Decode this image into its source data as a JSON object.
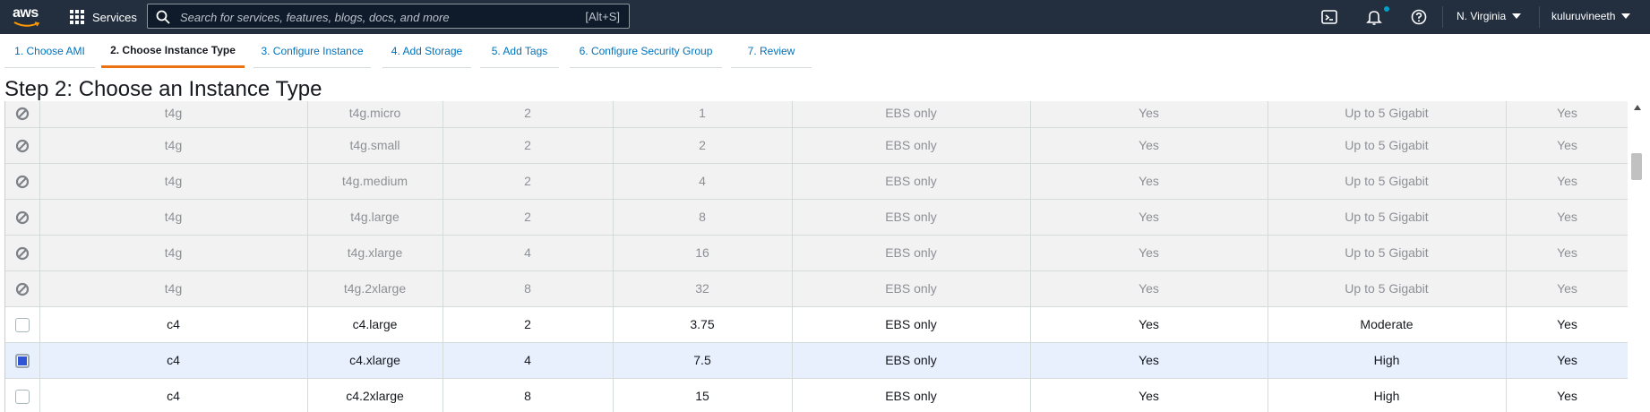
{
  "header": {
    "logo_text": "aws",
    "services_label": "Services",
    "search_placeholder": "Search for services, features, blogs, docs, and more",
    "search_shortcut": "[Alt+S]",
    "region": "N. Virginia",
    "user": "kuluruvineeth",
    "accent_color": "#ec7211",
    "notification_dot_color": "#00a1c9"
  },
  "wizard": {
    "tabs": [
      {
        "label": "1. Choose AMI"
      },
      {
        "label": "2. Choose Instance Type",
        "active": true
      },
      {
        "label": "3. Configure Instance"
      },
      {
        "label": "4. Add Storage"
      },
      {
        "label": "5. Add Tags"
      },
      {
        "label": "6. Configure Security Group"
      },
      {
        "label": "7. Review"
      }
    ]
  },
  "page": {
    "title": "Step 2: Choose an Instance Type"
  },
  "table": {
    "rows": [
      {
        "state": "disabled",
        "family": "t4g",
        "type": "t4g.micro",
        "vcpus": "2",
        "memory": "1",
        "storage": "EBS only",
        "ebs_optimized": "Yes",
        "network": "Up to 5 Gigabit",
        "ipv6": "Yes"
      },
      {
        "state": "disabled",
        "family": "t4g",
        "type": "t4g.small",
        "vcpus": "2",
        "memory": "2",
        "storage": "EBS only",
        "ebs_optimized": "Yes",
        "network": "Up to 5 Gigabit",
        "ipv6": "Yes"
      },
      {
        "state": "disabled",
        "family": "t4g",
        "type": "t4g.medium",
        "vcpus": "2",
        "memory": "4",
        "storage": "EBS only",
        "ebs_optimized": "Yes",
        "network": "Up to 5 Gigabit",
        "ipv6": "Yes"
      },
      {
        "state": "disabled",
        "family": "t4g",
        "type": "t4g.large",
        "vcpus": "2",
        "memory": "8",
        "storage": "EBS only",
        "ebs_optimized": "Yes",
        "network": "Up to 5 Gigabit",
        "ipv6": "Yes"
      },
      {
        "state": "disabled",
        "family": "t4g",
        "type": "t4g.xlarge",
        "vcpus": "4",
        "memory": "16",
        "storage": "EBS only",
        "ebs_optimized": "Yes",
        "network": "Up to 5 Gigabit",
        "ipv6": "Yes"
      },
      {
        "state": "disabled",
        "family": "t4g",
        "type": "t4g.2xlarge",
        "vcpus": "8",
        "memory": "32",
        "storage": "EBS only",
        "ebs_optimized": "Yes",
        "network": "Up to 5 Gigabit",
        "ipv6": "Yes"
      },
      {
        "state": "unchecked",
        "family": "c4",
        "type": "c4.large",
        "vcpus": "2",
        "memory": "3.75",
        "storage": "EBS only",
        "ebs_optimized": "Yes",
        "network": "Moderate",
        "ipv6": "Yes"
      },
      {
        "state": "checked",
        "family": "c4",
        "type": "c4.xlarge",
        "vcpus": "4",
        "memory": "7.5",
        "storage": "EBS only",
        "ebs_optimized": "Yes",
        "network": "High",
        "ipv6": "Yes"
      },
      {
        "state": "unchecked",
        "family": "c4",
        "type": "c4.2xlarge",
        "vcpus": "8",
        "memory": "15",
        "storage": "EBS only",
        "ebs_optimized": "Yes",
        "network": "High",
        "ipv6": "Yes"
      }
    ]
  }
}
